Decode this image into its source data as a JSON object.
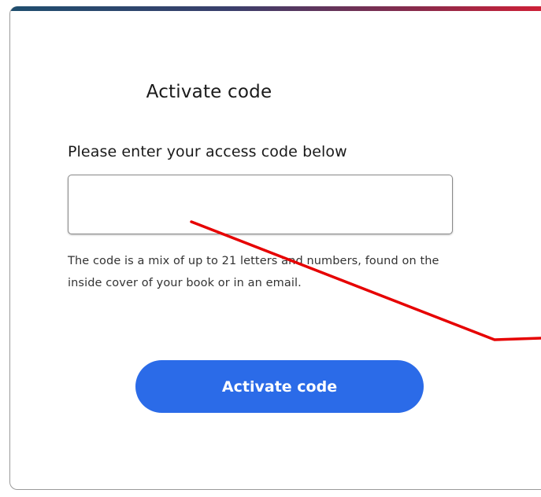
{
  "dialog": {
    "title": "Activate code",
    "field_label": "Please enter your access code below",
    "input_value": "",
    "input_placeholder": "",
    "help_text": "The code is a mix of up to 21 letters and numbers, found on the inside cover of your book or in an email.",
    "submit_label": "Activate code"
  },
  "colors": {
    "button": "#2b6be8",
    "accent_start": "#1f4e6e",
    "accent_end": "#d81e34",
    "annotation_line": "#e60000"
  }
}
